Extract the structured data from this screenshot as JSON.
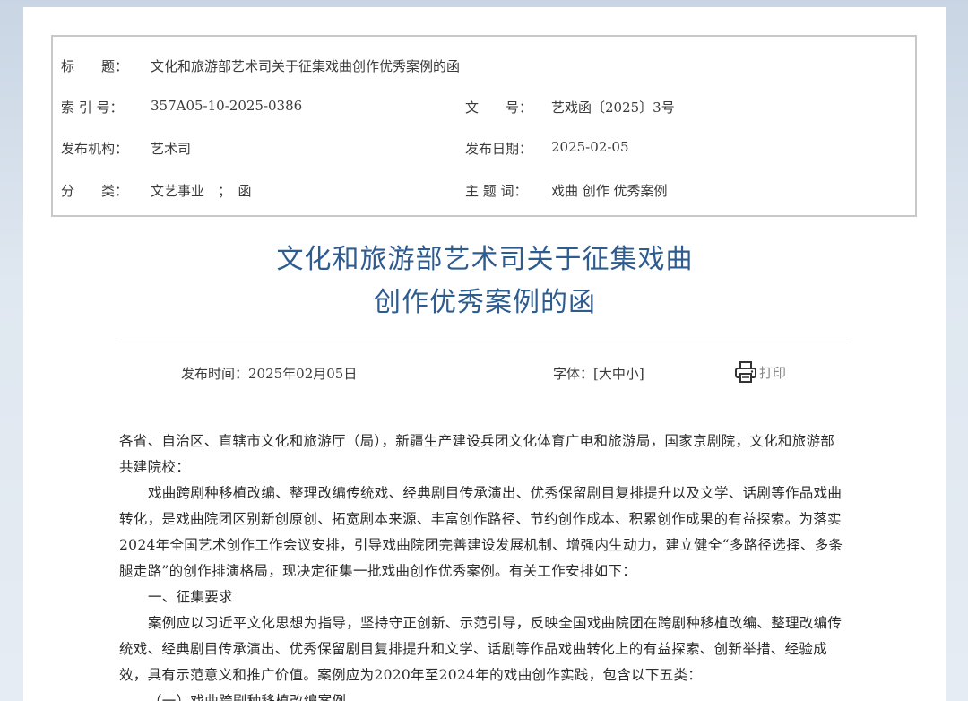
{
  "meta": {
    "title_label": "标　　题：",
    "title_value": "文化和旅游部艺术司关于征集戏曲创作优秀案例的函",
    "index_label": "索 引 号：",
    "index_value": "357A05-10-2025-0386",
    "docno_label": "文　　号：",
    "docno_value": "艺戏函〔2025〕3号",
    "org_label": "发布机构：",
    "org_value": "艺术司",
    "date_label": "发布日期：",
    "date_value": "2025-02-05",
    "category_label": "分　　类：",
    "category_value": "文艺事业　；　函",
    "keywords_label": "主 题 词：",
    "keywords_value": "戏曲 创作 优秀案例"
  },
  "doc_title": {
    "line1": "文化和旅游部艺术司关于征集戏曲",
    "line2": "创作优秀案例的函"
  },
  "pub": {
    "time": "发布时间：2025年02月05日",
    "font_label": "字体：",
    "font_options": "[大中小]",
    "print_label": "打印"
  },
  "body": {
    "salutation": "各省、自治区、直辖市文化和旅游厅（局），新疆生产建设兵团文化体育广电和旅游局，国家京剧院，文化和旅游部共建院校：",
    "para1": "戏曲跨剧种移植改编、整理改编传统戏、经典剧目传承演出、优秀保留剧目复排提升以及文学、话剧等作品戏曲转化，是戏曲院团区别新创原创、拓宽剧本来源、丰富创作路径、节约创作成本、积累创作成果的有益探索。为落实2024年全国艺术创作工作会议安排，引导戏曲院团完善建设发展机制、增强内生动力，建立健全“多路径选择、多条腿走路”的创作排演格局，现决定征集一批戏曲创作优秀案例。有关工作安排如下：",
    "section1": "一、征集要求",
    "para2": "案例应以习近平文化思想为指导，坚持守正创新、示范引导，反映全国戏曲院团在跨剧种移植改编、整理改编传统戏、经典剧目传承演出、优秀保留剧目复排提升和文学、话剧等作品戏曲转化上的有益探索、创新举措、经验成效，具有示范意义和推广价值。案例应为2020年至2024年的戏曲创作实践，包含以下五类：",
    "sub1": "（一）戏曲跨剧种移植改编案例"
  },
  "colors": {
    "title_blue": "#2f5c8f",
    "border_gray": "#c8c8c8",
    "background": "#dfe7f0"
  }
}
